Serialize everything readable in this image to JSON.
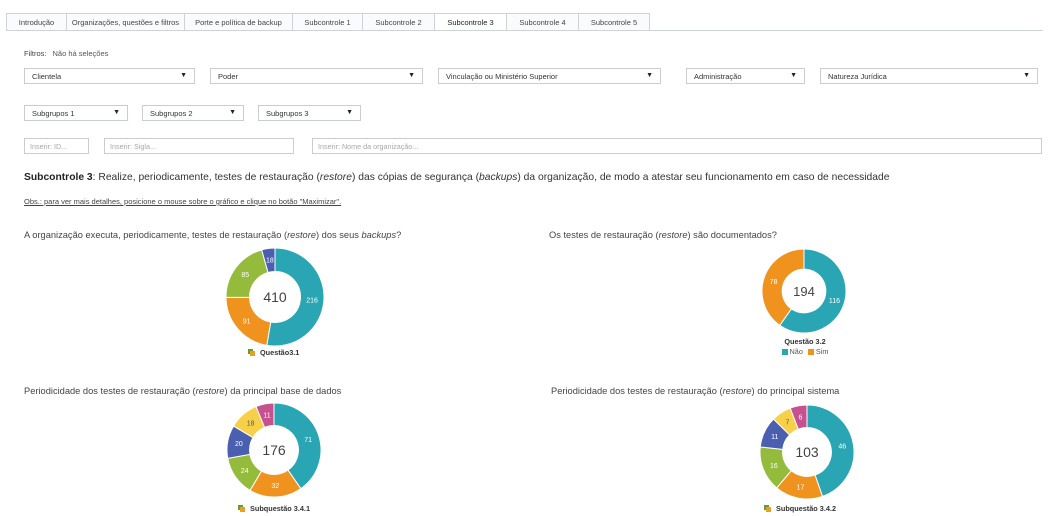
{
  "tabs": [
    {
      "label": "Introdução",
      "active": false
    },
    {
      "label": "Organizações, questões e filtros",
      "active": false
    },
    {
      "label": "Porte e política de backup",
      "active": false
    },
    {
      "label": "Subcontrole 1",
      "active": false
    },
    {
      "label": "Subcontrole 2",
      "active": false
    },
    {
      "label": "Subcontrole 3",
      "active": true
    },
    {
      "label": "Subcontrole 4",
      "active": false
    },
    {
      "label": "Subcontrole 5",
      "active": false
    }
  ],
  "filters": {
    "label": "Filtros:",
    "value": "Não há seleções"
  },
  "dropdowns": {
    "clientela": "Clientela",
    "poder": "Poder",
    "vinculacao": "Vinculação ou Ministério Superior",
    "administracao": "Administração",
    "natureza": "Natureza Jurídica",
    "subgrupos1": "Subgrupos 1",
    "subgrupos2": "Subgrupos 2",
    "subgrupos3": "Subgrupos 3"
  },
  "inputs": {
    "id_placeholder": "Inserir: ID...",
    "sigla_placeholder": "Inserir: Sigla...",
    "nome_placeholder": "Inserir: Nome da organização..."
  },
  "heading": {
    "bold": "Subcontrole 3",
    "p1": ": Realize, periodicamente, testes de restauração (",
    "i1": "restore",
    "p2": ") das cópias de segurança (",
    "i2": "backups",
    "p3": ") da organização, de modo a atestar seu funcionamento em caso de necessidade"
  },
  "note": "Obs.: para ver mais detalhes, posicione o mouse sobre o gráfico e clique no botão \"Maximizar\".",
  "charts": {
    "q31": {
      "t1": "A organização executa, periodicamente, testes de restauração (",
      "i1": "restore",
      "t2": ") dos seus ",
      "i2": "backups",
      "t3": "?",
      "legend": "Questão3.1"
    },
    "q32": {
      "t1": "Os testes de restauração (",
      "i1": "restore",
      "t2": ") são documentados?",
      "legend_title": "Questão 3.2",
      "legend_a": "Não",
      "legend_b": "Sim"
    },
    "q341": {
      "t1": "Periodicidade dos testes de restauração (",
      "i1": "restore",
      "t2": ") da principal base de dados",
      "legend": "Subquestão 3.4.1"
    },
    "q342": {
      "t1": "Periodicidade dos testes de restauração (",
      "i1": "restore",
      "t2": ") do principal sistema",
      "legend": "Subquestão 3.4.2"
    }
  },
  "colors": {
    "teal": "#2aa5b3",
    "orange": "#f0921e",
    "green": "#94bb3c",
    "blue": "#4a5fb0",
    "yellow": "#f7d04a",
    "pink": "#c7508f"
  },
  "chart_data": [
    {
      "type": "pie",
      "id": "q31",
      "total": 410,
      "slices": [
        {
          "value": 216,
          "color": "#2aa5b3"
        },
        {
          "value": 91,
          "color": "#f0921e"
        },
        {
          "value": 85,
          "color": "#94bb3c"
        },
        {
          "value": 18,
          "color": "#4a5fb0"
        }
      ]
    },
    {
      "type": "pie",
      "id": "q32",
      "total": 194,
      "slices": [
        {
          "value": 116,
          "color": "#2aa5b3",
          "name": "Não"
        },
        {
          "value": 78,
          "color": "#f0921e",
          "name": "Sim"
        }
      ]
    },
    {
      "type": "pie",
      "id": "q341",
      "total": 176,
      "slices": [
        {
          "value": 71,
          "color": "#2aa5b3"
        },
        {
          "value": 32,
          "color": "#f0921e"
        },
        {
          "value": 24,
          "color": "#94bb3c"
        },
        {
          "value": 20,
          "color": "#4a5fb0"
        },
        {
          "value": 18,
          "color": "#f7d04a"
        },
        {
          "value": 11,
          "color": "#c7508f"
        }
      ]
    },
    {
      "type": "pie",
      "id": "q342",
      "total": 103,
      "slices": [
        {
          "value": 46,
          "color": "#2aa5b3"
        },
        {
          "value": 17,
          "color": "#f0921e"
        },
        {
          "value": 16,
          "color": "#94bb3c"
        },
        {
          "value": 11,
          "color": "#4a5fb0"
        },
        {
          "value": 7,
          "color": "#f7d04a"
        },
        {
          "value": 6,
          "color": "#c7508f"
        }
      ]
    }
  ]
}
